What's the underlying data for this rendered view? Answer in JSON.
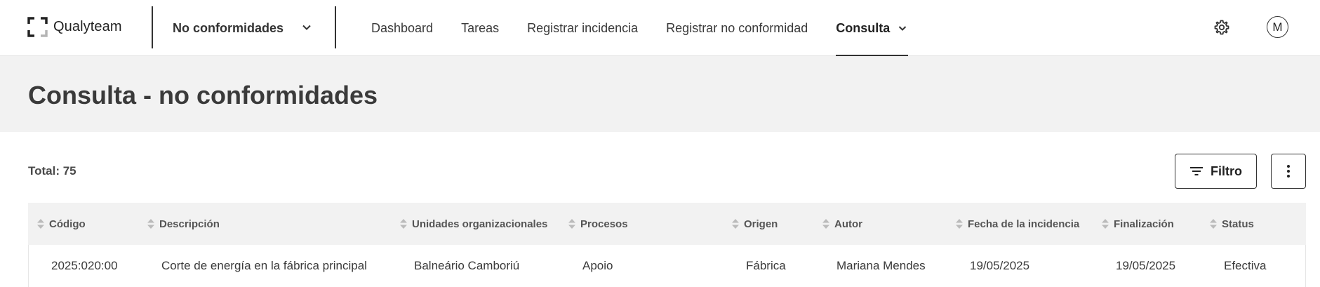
{
  "brand": {
    "name": "Qualyteam"
  },
  "module_select": {
    "value": "No conformidades"
  },
  "nav": [
    {
      "label": "Dashboard"
    },
    {
      "label": "Tareas"
    },
    {
      "label": "Registrar incidencia"
    },
    {
      "label": "Registrar no conformidad"
    },
    {
      "label": "Consulta",
      "active": true
    }
  ],
  "user": {
    "initial": "M"
  },
  "page": {
    "title": "Consulta - no conformidades"
  },
  "toolbar": {
    "total": "Total: 75",
    "filter_label": "Filtro"
  },
  "table": {
    "columns": [
      "Código",
      "Descripción",
      "Unidades organizacionales",
      "Procesos",
      "Origen",
      "Autor",
      "Fecha de la incidencia",
      "Finalización",
      "Status"
    ],
    "rows": [
      [
        "2025:020:00",
        "Corte de energía en la fábrica principal",
        "Balneário Camboriú",
        "Apoio",
        "Fábrica",
        "Mariana Mendes",
        "19/05/2025",
        "19/05/2025",
        "Efectiva"
      ]
    ]
  },
  "colors": {
    "accent": "#333333",
    "band": "#f2f2f2",
    "logo_gray": "#b5b5b5"
  },
  "icons": [
    "logo-icon",
    "chevron-down-icon",
    "gear-icon",
    "filter-icon",
    "more-vertical-icon",
    "sort-icon"
  ]
}
